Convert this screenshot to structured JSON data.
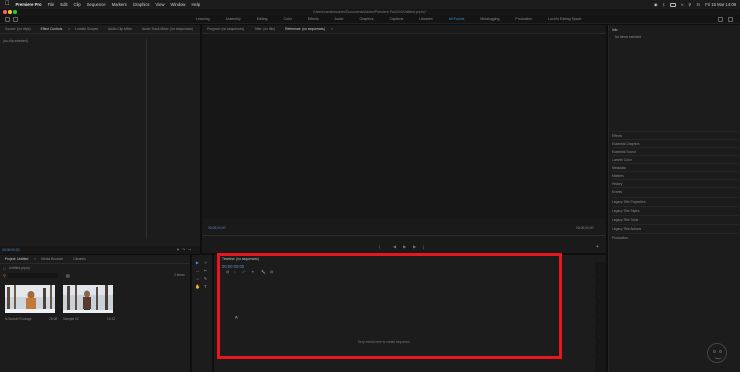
{
  "menubar": {
    "items": [
      "Premiere Pro",
      "File",
      "Edit",
      "Clip",
      "Sequence",
      "Markers",
      "Graphics",
      "View",
      "Window",
      "Help"
    ],
    "datetime": "Fri 15 Mar 14:09"
  },
  "titlebar": {
    "title": "/Users/carolinecohen/Documents/Adobe/Premiere Pro/24.0/Untitled.prproj *"
  },
  "workspaces": {
    "tabs": [
      "Learning",
      "Assembly",
      "Editing",
      "Color",
      "Effects",
      "Audio",
      "Graphics",
      "Captions",
      "Libraries",
      "All Panels",
      "Metalogging",
      "Production",
      "Luchi's Editing Space"
    ],
    "active_index": 9
  },
  "source_panel": {
    "tabs": [
      "Source: (no clips)",
      "Effect Controls",
      "Lumetri Scopes",
      "Audio Clip Mixer",
      "Audio Track Mixer: (no sequences)"
    ],
    "active_index": 1,
    "no_clip_text": "(no clip selected)",
    "timecode": "00:00:00:00"
  },
  "program_panel": {
    "tabs": [
      "Program: (no sequences)",
      "Titler: (no title)",
      "Reference: (no sequences)"
    ],
    "active_index": 2,
    "timecode_left": "00;00;00;00",
    "timecode_right": "00;00;00;00"
  },
  "info_panel": {
    "title": "Info",
    "no_item_text": "No items selected",
    "items": [
      "Effects",
      "Essential Graphics",
      "Essential Sound",
      "Lumetri Color",
      "Metadata",
      "Markers",
      "History",
      "Events",
      "Legacy Title Properties",
      "Legacy Title Styles",
      "Legacy Title Tools",
      "Legacy Title Actions",
      "Production"
    ]
  },
  "project_panel": {
    "tabs": [
      "Project: Untitled",
      "Media Browser",
      "Libraries"
    ],
    "active_index": 0,
    "file_name": "Untitled.prproj",
    "item_count": "2 items",
    "clips": [
      {
        "name": "N.Sunset Footage",
        "duration": "25:08"
      },
      {
        "name": "Sample 02",
        "duration": "10:12"
      }
    ]
  },
  "timeline": {
    "tab": "Timeline: (no sequences)",
    "timecode": "00:00:00:00",
    "empty_text": "Drop media here to create sequence."
  },
  "colors": {
    "accent": "#3d8bd8",
    "highlight": "#e8161e",
    "panel_bg": "#1c1c1c",
    "app_bg": "#0e0e0e"
  }
}
